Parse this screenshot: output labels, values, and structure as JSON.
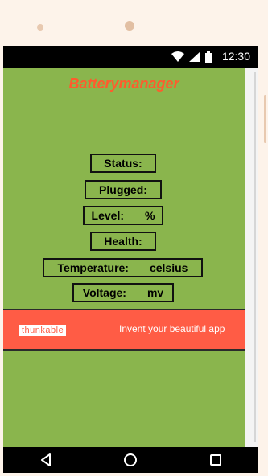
{
  "status_bar": {
    "time": "12:30",
    "icons": [
      "wifi-icon",
      "signal-icon",
      "battery-icon"
    ]
  },
  "app": {
    "title": "Batterymanager"
  },
  "fields": {
    "status": {
      "label": "Status:",
      "value": ""
    },
    "plugged": {
      "label": "Plugged:",
      "value": ""
    },
    "level": {
      "label": "Level:",
      "unit": "%"
    },
    "health": {
      "label": "Health:",
      "value": ""
    },
    "temperature": {
      "label": "Temperature:",
      "unit": "celsius"
    },
    "voltage": {
      "label": "Voltage:",
      "unit": "mv"
    }
  },
  "ad": {
    "brand": "thunkable",
    "text": "Invent your beautiful app"
  },
  "navigation": {
    "icons": [
      "back-icon",
      "home-icon",
      "recents-icon"
    ]
  },
  "colors": {
    "background": "#8ab54d",
    "title": "#ff5b2d",
    "ad_background": "#ff5c45"
  }
}
